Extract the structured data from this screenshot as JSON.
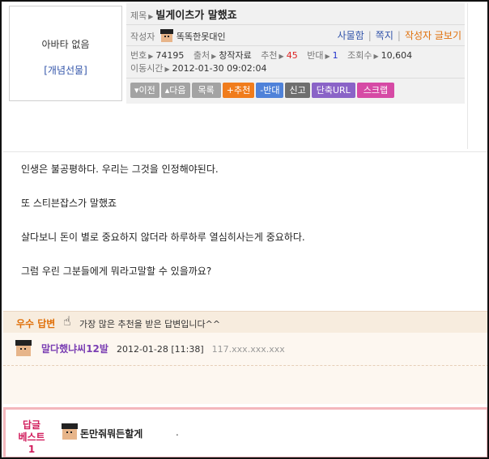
{
  "avatar": {
    "empty_text": "아바타 없음",
    "gift_link": "[개념선물]"
  },
  "post": {
    "title_label": "제목",
    "title": "빌게이츠가 말했죠",
    "author_label": "작성자",
    "author": "똑똑한못대인",
    "actions": {
      "note": "사물함",
      "message": "쪽지",
      "author_posts": "작성자 글보기"
    },
    "meta": {
      "no_label": "번호",
      "no": "74195",
      "source_label": "출처",
      "source": "창작자료",
      "recommend_label": "추천",
      "recommend": "45",
      "oppose_label": "반대",
      "oppose": "1",
      "views_label": "조회수",
      "views": "10,604",
      "moved_label": "이동시간",
      "moved": "2012-01-30 09:02:04"
    },
    "buttons": {
      "prev": "▾이전",
      "next": "▴다음",
      "list": "목록",
      "recommend": "+추천",
      "oppose": "-반대",
      "report": "신고",
      "short_url": "단축URL",
      "scrap": "스크랩"
    },
    "body": [
      "인생은 불공평하다. 우리는 그것을 인정해야된다.",
      "또 스티븐잡스가 말했죠",
      "살다보니 돈이 별로 중요하지 않더라 하루하루 열심히사는게 중요하다.",
      "그럼 우린 그분들에게 뭐라고말할 수 있을까요?"
    ]
  },
  "best_answer": {
    "label": "우수 답변",
    "description": "가장 많은 추천을 받은 답변입니다^^",
    "author": "말다했냐씨12발",
    "date": "2012-01-28 [11:38]",
    "ip": "117.xxx.xxx.xxx"
  },
  "reply_best": {
    "label_line1": "답글",
    "label_line2": "베스트1",
    "text": "돈만줘뭐든할게",
    "dot": "."
  },
  "colors": {
    "accent_orange": "#e0700a",
    "link_blue": "#3355aa",
    "border_pink": "#f4b7bd",
    "name_purple": "#7b3fb3"
  },
  "icons": [
    "pixel-face-icon",
    "hand-pointer-icon",
    "triangle-right-icon"
  ]
}
